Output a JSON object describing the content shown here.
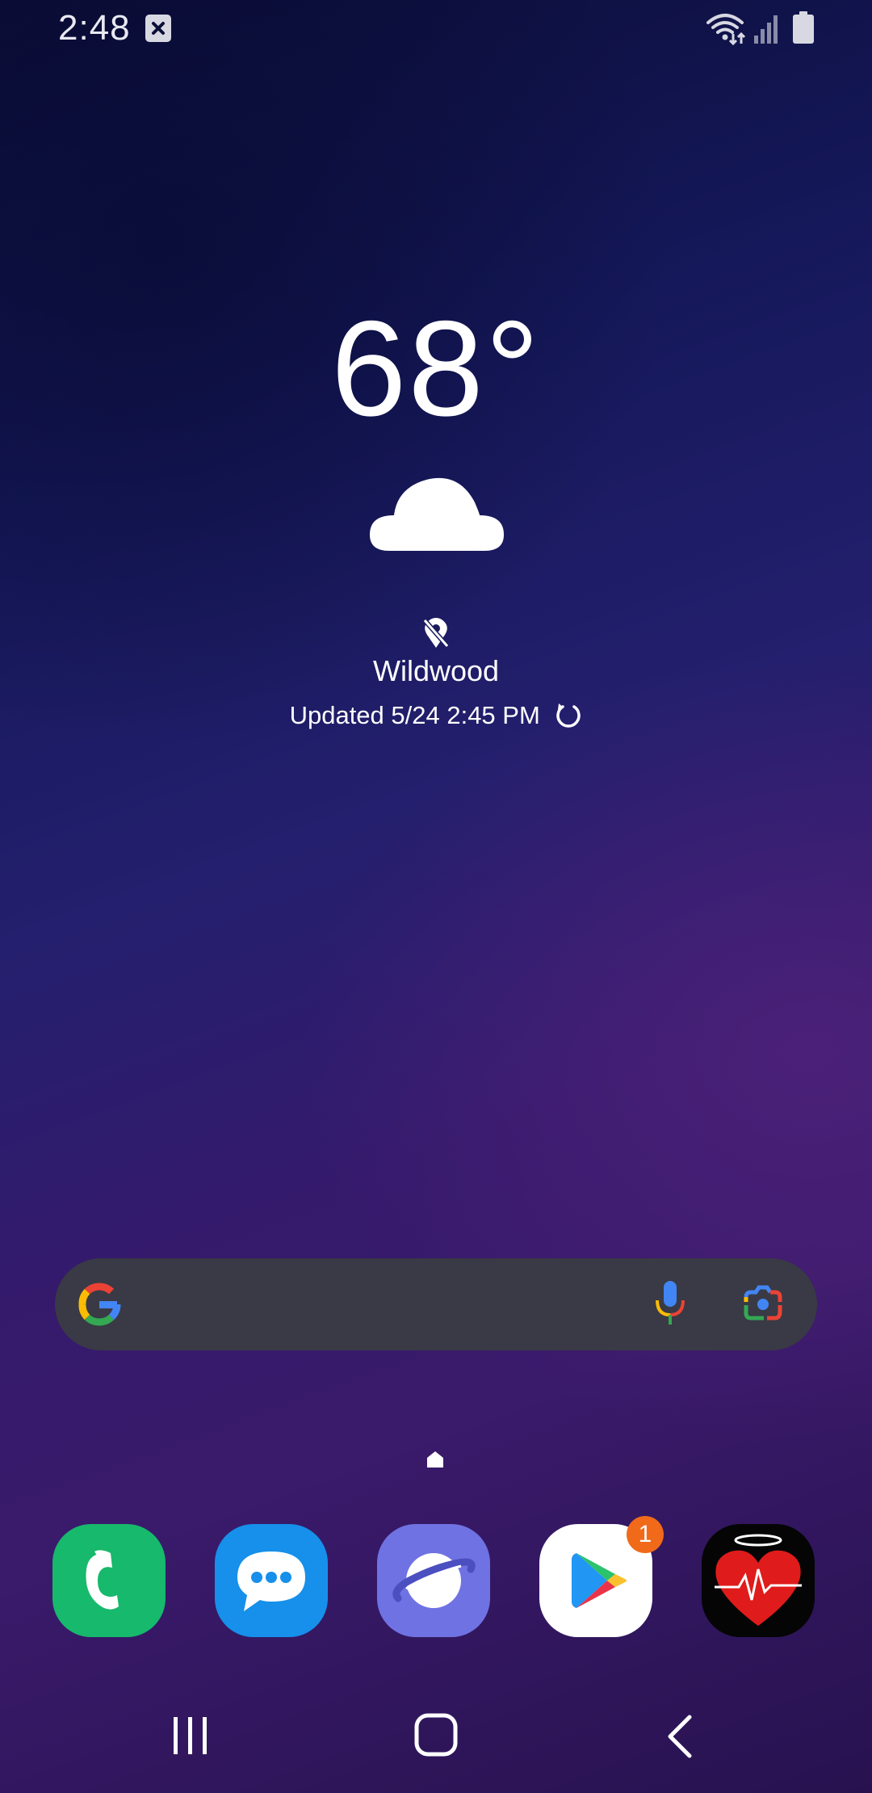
{
  "status_bar": {
    "time": "2:48",
    "icons": [
      "notification-close-icon",
      "wifi-icon",
      "signal-icon",
      "battery-icon"
    ]
  },
  "weather": {
    "temperature": "68°",
    "condition_icon": "cloud-icon",
    "location": "Wildwood",
    "updated": "Updated 5/24 2:45 PM"
  },
  "search_bar": {
    "icons": [
      "google-icon",
      "mic-icon",
      "lens-icon"
    ]
  },
  "dock": {
    "apps": [
      {
        "name": "phone",
        "color": "#17b96c"
      },
      {
        "name": "messages",
        "color": "#1690ea"
      },
      {
        "name": "internet",
        "color": "#6f72e2"
      },
      {
        "name": "play-store",
        "color": "#ffffff",
        "badge": "1"
      },
      {
        "name": "heart-monitor",
        "color": "#050505"
      }
    ]
  },
  "nav_bar": {
    "icons": [
      "recents-icon",
      "home-icon",
      "back-icon"
    ]
  },
  "colors": {
    "search_bg": "#393a45",
    "badge": "#f06a1a"
  }
}
